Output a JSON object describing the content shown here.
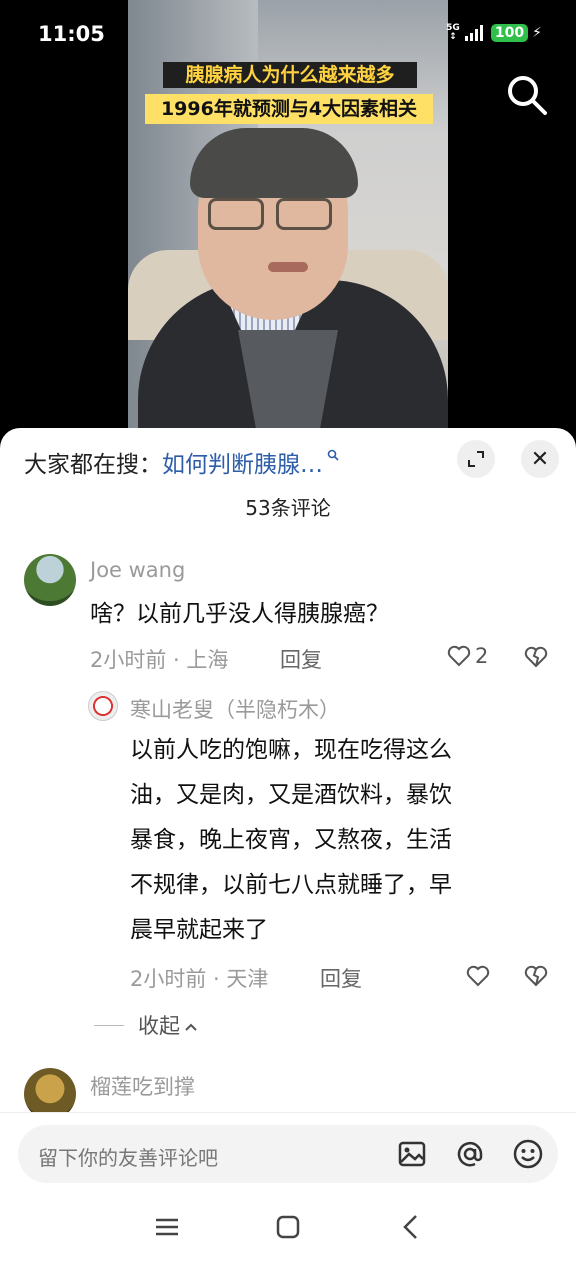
{
  "status": {
    "time": "11:05",
    "network": "5G",
    "battery": "100"
  },
  "video": {
    "caption_line1": "胰腺病人为什么越来越多",
    "caption_line2": "1996年就预测与4大因素相关"
  },
  "sheet": {
    "hot_search_prefix": "大家都在搜：",
    "hot_search_query": "如何判断胰腺…",
    "comment_count": "53条评论"
  },
  "comments": [
    {
      "username": "Joe  wang",
      "text": "啥？以前几乎没人得胰腺癌？",
      "time_location": "2小时前 · 上海",
      "reply_label": "回复",
      "likes": "2"
    },
    {
      "username": "寒山老叟（半隐朽木）",
      "text_lines": [
        "以前人吃的饱嘛，现在吃得这么",
        "油，又是肉，又是酒饮料，暴饮",
        "暴食，晚上夜宵，又熬夜，生活",
        "不规律，以前七八点就睡了，早",
        "晨早就起来了"
      ],
      "time_location": "2小时前 · 天津",
      "reply_label": "回复"
    },
    {
      "username": "榴莲吃到撑"
    }
  ],
  "collapse_label": "收起",
  "input_placeholder": "留下你的友善评论吧",
  "colors": {
    "link_blue": "#2f5ea8",
    "battery_green": "#2fbf4a",
    "caption_yellow": "#ffe066"
  }
}
